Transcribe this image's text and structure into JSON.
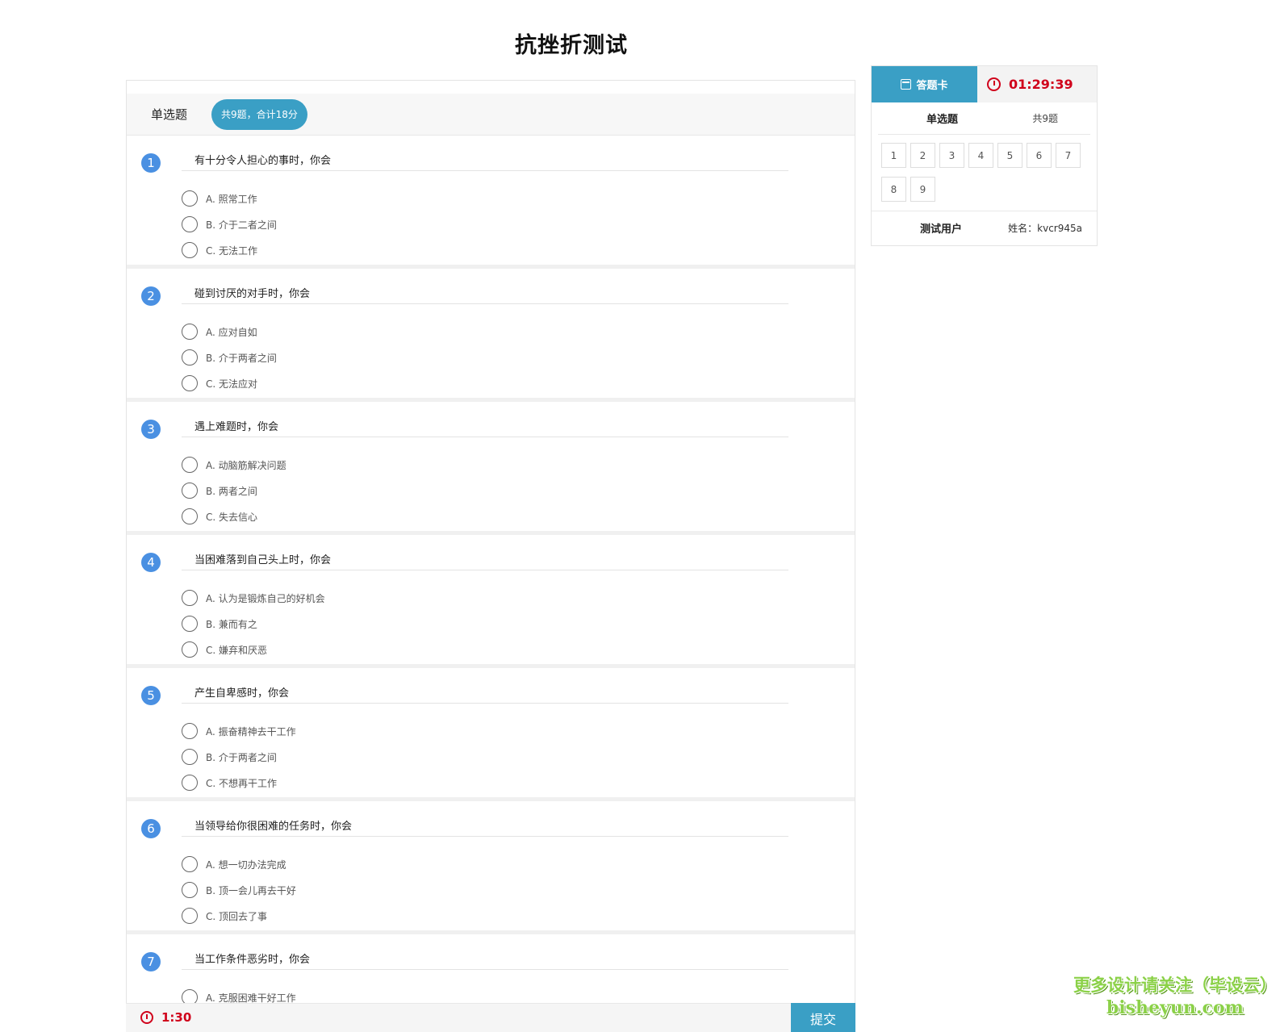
{
  "page": {
    "title": "抗挫折测试"
  },
  "section": {
    "title": "单选题",
    "summary": "共9题，合计18分"
  },
  "questions": [
    {
      "num": "1",
      "text": "有十分令人担心的事时，你会",
      "options": [
        "A. 照常工作",
        "B. 介于二者之间",
        "C. 无法工作"
      ]
    },
    {
      "num": "2",
      "text": "碰到讨厌的对手时，你会",
      "options": [
        "A. 应对自如",
        "B. 介于两者之间",
        "C. 无法应对"
      ]
    },
    {
      "num": "3",
      "text": "遇上难题时，你会",
      "options": [
        "A. 动脑筋解决问题",
        "B. 两者之间",
        "C. 失去信心"
      ]
    },
    {
      "num": "4",
      "text": "当困难落到自己头上时，你会",
      "options": [
        "A. 认为是锻炼自己的好机会",
        "B. 兼而有之",
        "C. 嫌弃和厌恶"
      ]
    },
    {
      "num": "5",
      "text": "产生自卑感时，你会",
      "options": [
        "A. 振奋精神去干工作",
        "B. 介于两者之间",
        "C. 不想再干工作"
      ]
    },
    {
      "num": "6",
      "text": "当领导给你很困难的任务时，你会",
      "options": [
        "A. 想一切办法完成",
        "B. 顶一会儿再去干好",
        "C. 顶回去了事"
      ]
    },
    {
      "num": "7",
      "text": "当工作条件恶劣时，你会",
      "options": [
        "A. 克服困难干好工作"
      ]
    }
  ],
  "bottom_bar": {
    "time": "1:30",
    "submit_label": "提交"
  },
  "side_card": {
    "tab_label": "答题卡",
    "timer": "01:29:39",
    "section_label": "单选题",
    "section_count": "共9题",
    "numbers": [
      "1",
      "2",
      "3",
      "4",
      "5",
      "6",
      "7",
      "8",
      "9"
    ],
    "user_label": "测试用户",
    "user_name": "姓名：kvcr945a"
  },
  "watermark": {
    "line1": "更多设计请关注（毕设云）",
    "line2": "bisheyun.com"
  },
  "colors": {
    "accent": "#3a9fc5",
    "question_number": "#4a90e2",
    "timer": "#d0021b",
    "watermark": "#8bd148"
  },
  "icons": {
    "tab_icon": "calendar-check-icon",
    "timer_icon": "clock-icon"
  }
}
